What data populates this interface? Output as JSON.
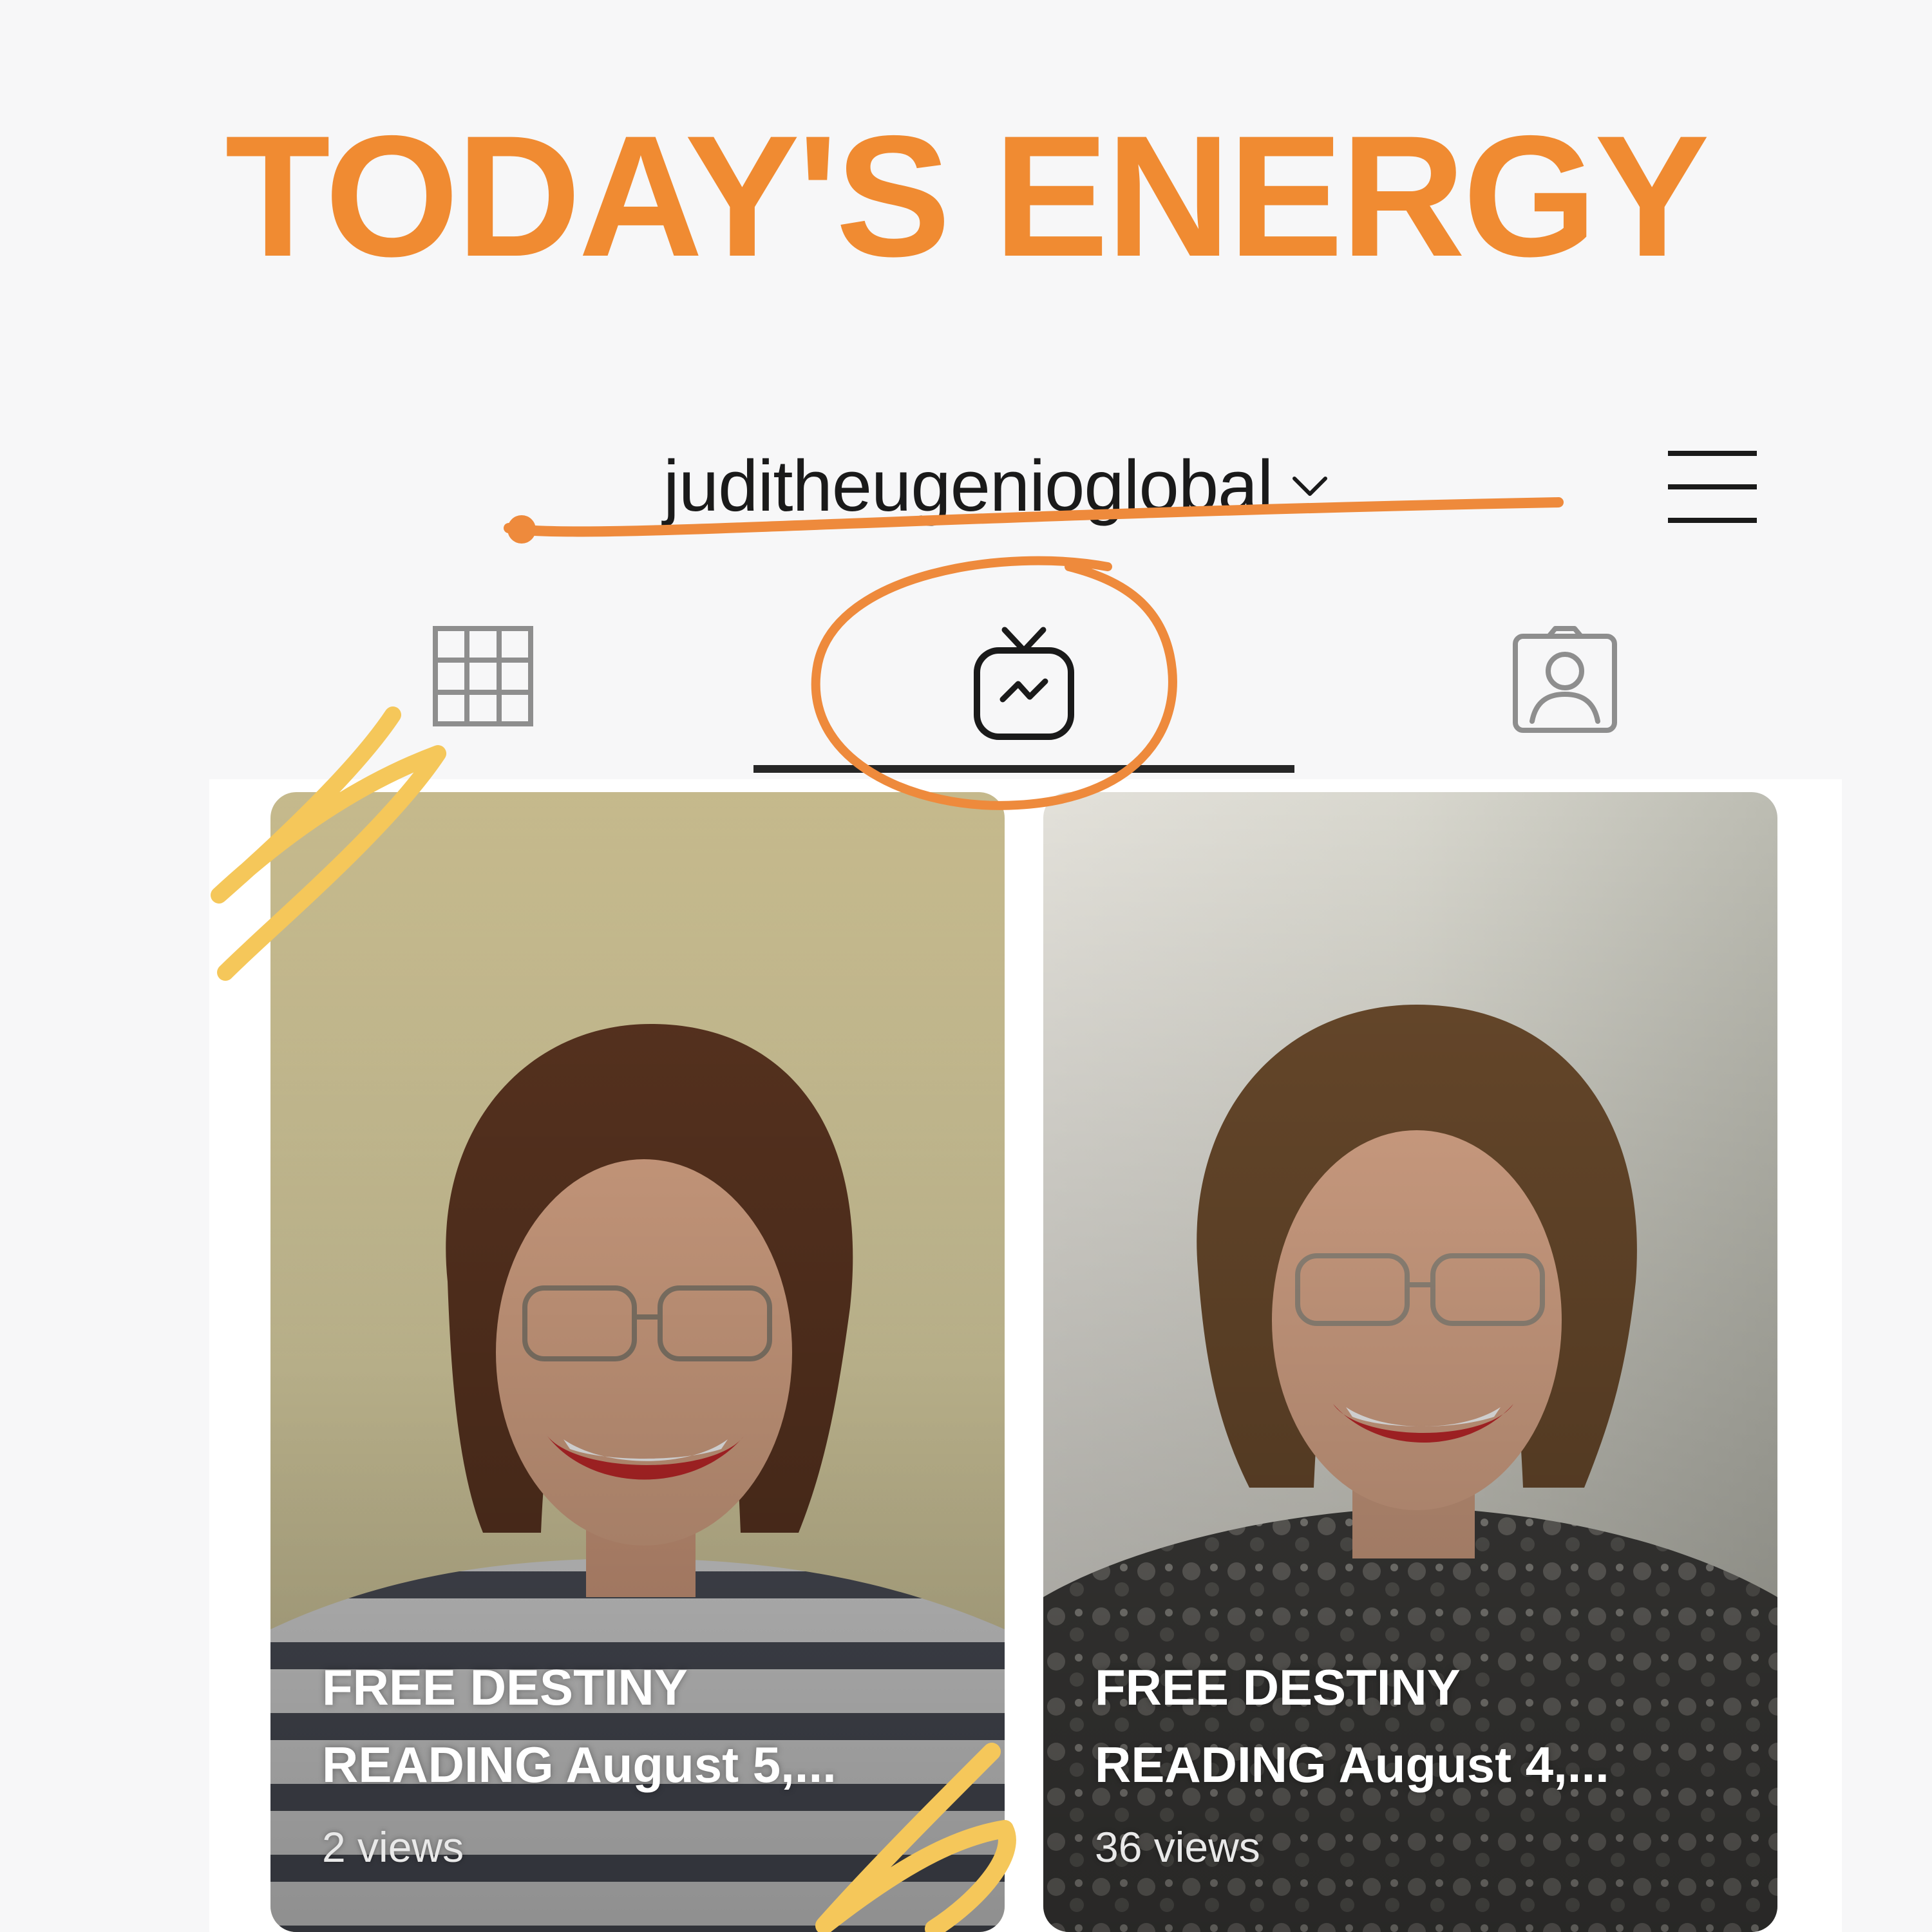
{
  "headline": {
    "text": "TODAY'S ENERGY"
  },
  "profile": {
    "username": "juditheugenioglobal",
    "username_dropdown_icon": "chevron-down-icon",
    "menu_icon": "hamburger-menu-icon"
  },
  "tabs": [
    {
      "id": "posts",
      "icon": "grid-icon",
      "active": false
    },
    {
      "id": "igtv",
      "icon": "igtv-icon",
      "active": true
    },
    {
      "id": "tagged",
      "icon": "tagged-person-icon",
      "active": false
    }
  ],
  "videos": [
    {
      "title_line1": "FREE DESTINY",
      "title_line2": "READING August 5,...",
      "views": "2 views"
    },
    {
      "title_line1": "FREE DESTINY",
      "title_line2": "READING August 4,...",
      "views": "36 views"
    }
  ],
  "colors": {
    "headline": "#f08b32",
    "annotation_orange": "#ee8a3c",
    "annotation_yellow": "#f5c75a",
    "active_tab_underline": "#262626",
    "icon_gray": "#8e8e8e"
  }
}
